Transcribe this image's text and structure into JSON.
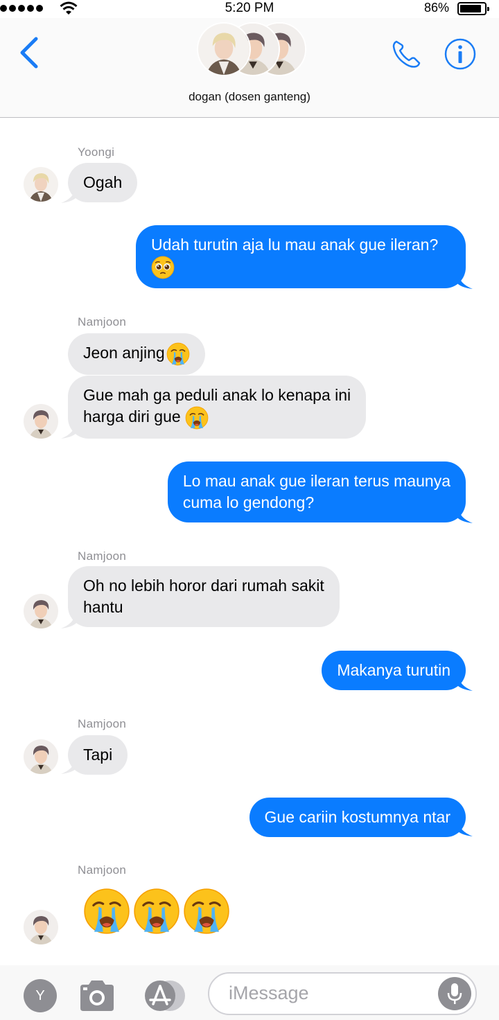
{
  "status_bar": {
    "time": "5:20 PM",
    "battery": "86%"
  },
  "header": {
    "group_name": "dogan (dosen ganteng)"
  },
  "chat": {
    "messages": [
      {
        "sender": "Yoongi",
        "text": "Ogah"
      },
      {
        "text": "Udah turutin aja lu mau anak gue ileran?",
        "emoji": "pleading-face"
      },
      {
        "sender": "Namjoon",
        "text": "Jeon anjing",
        "emoji": "loudly-crying-face"
      },
      {
        "line1": "Gue mah ga peduli anak lo kenapa ini",
        "line2": "harga diri gue",
        "emoji": "loudly-crying-face"
      },
      {
        "line1": "Lo mau anak gue ileran terus maunya",
        "line2": "cuma lo gendong?"
      },
      {
        "sender": "Namjoon",
        "line1": "Oh no lebih horor dari rumah sakit",
        "line2": "hantu"
      },
      {
        "text": "Makanya turutin"
      },
      {
        "sender": "Namjoon",
        "text": "Tapi"
      },
      {
        "text": "Gue cariin kostumnya ntar"
      },
      {
        "sender": "Namjoon",
        "emojis": [
          "loudly-crying-face",
          "loudly-crying-face",
          "loudly-crying-face"
        ]
      }
    ]
  },
  "input_bar": {
    "avatar_letter": "Y",
    "placeholder": "iMessage"
  },
  "colors": {
    "accent": "#0a7cff",
    "incoming_bubble": "#e9e9eb",
    "icon_blue": "#1a7cf5",
    "gray_button": "#8e8e93"
  }
}
